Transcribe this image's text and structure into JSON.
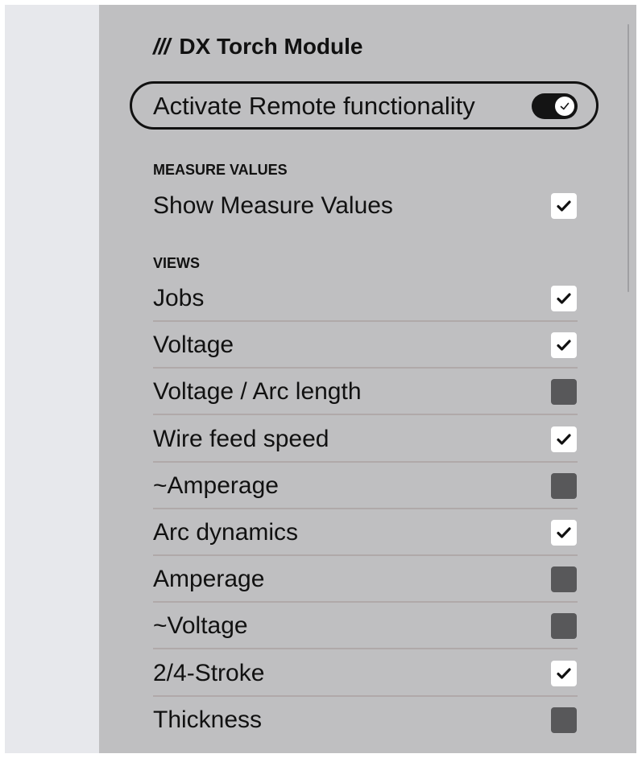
{
  "module": {
    "title": "DX Torch Module",
    "prefix_icon": "triple-slash-icon"
  },
  "remote": {
    "label": "Activate Remote functionality",
    "enabled": true
  },
  "measure_values": {
    "heading": "MEASURE VALUES",
    "items": [
      {
        "label": "Show Measure Values",
        "checked": true
      }
    ]
  },
  "views": {
    "heading": "VIEWS",
    "items": [
      {
        "label": "Jobs",
        "checked": true
      },
      {
        "label": "Voltage",
        "checked": true
      },
      {
        "label": "Voltage / Arc length",
        "checked": false
      },
      {
        "label": "Wire feed speed",
        "checked": true
      },
      {
        "label": "~Amperage",
        "checked": false
      },
      {
        "label": "Arc dynamics",
        "checked": true
      },
      {
        "label": "Amperage",
        "checked": false
      },
      {
        "label": "~Voltage",
        "checked": false
      },
      {
        "label": "2/4-Stroke",
        "checked": true
      },
      {
        "label": "Thickness",
        "checked": false
      }
    ]
  },
  "colors": {
    "panel_background": "#bfbfc1",
    "side_strip": "#e7e8ec",
    "checkbox_checked": "#ffffff",
    "checkbox_unchecked": "#58585a",
    "toggle_on": "#141414"
  }
}
